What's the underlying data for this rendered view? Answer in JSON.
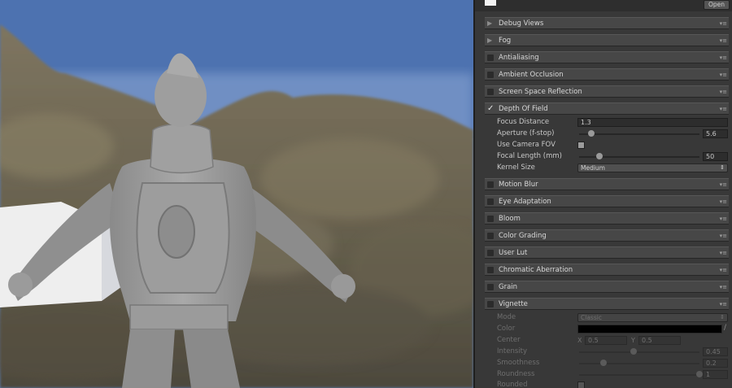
{
  "topbar": {
    "open_label": "Open"
  },
  "sections": {
    "debug_views": {
      "label": "Debug Views"
    },
    "fog": {
      "label": "Fog"
    },
    "antialiasing": {
      "label": "Antialiasing"
    },
    "ambient_occlusion": {
      "label": "Ambient Occlusion"
    },
    "screen_space_reflection": {
      "label": "Screen Space Reflection"
    },
    "depth_of_field": {
      "label": "Depth Of Field"
    },
    "motion_blur": {
      "label": "Motion Blur"
    },
    "eye_adaptation": {
      "label": "Eye Adaptation"
    },
    "bloom": {
      "label": "Bloom"
    },
    "color_grading": {
      "label": "Color Grading"
    },
    "user_lut": {
      "label": "User Lut"
    },
    "chromatic_aberration": {
      "label": "Chromatic Aberration"
    },
    "grain": {
      "label": "Grain"
    },
    "vignette": {
      "label": "Vignette"
    }
  },
  "depth_of_field": {
    "focus_distance": {
      "label": "Focus Distance",
      "value": "1.3"
    },
    "aperture": {
      "label": "Aperture (f-stop)",
      "value": "5.6",
      "fraction": 0.1
    },
    "use_camera_fov": {
      "label": "Use Camera FOV",
      "checked": false
    },
    "focal_length": {
      "label": "Focal Length (mm)",
      "value": "50",
      "fraction": 0.17
    },
    "kernel_size": {
      "label": "Kernel Size",
      "value": "Medium"
    }
  },
  "vignette": {
    "mode": {
      "label": "Mode",
      "value": "Classic"
    },
    "color": {
      "label": "Color",
      "value": "#000000"
    },
    "center": {
      "label": "Center",
      "x_label": "X",
      "x_value": "0.5",
      "y_label": "Y",
      "y_value": "0.5"
    },
    "intensity": {
      "label": "Intensity",
      "value": "0.45",
      "fraction": 0.45
    },
    "smoothness": {
      "label": "Smoothness",
      "value": "0.2",
      "fraction": 0.2
    },
    "roundness": {
      "label": "Roundness",
      "value": "1",
      "fraction": 1.0
    },
    "rounded": {
      "label": "Rounded",
      "checked": false
    }
  },
  "colors": {
    "panel_bg": "#383838",
    "header_bg": "#474747",
    "field_bg": "#2d2d2d"
  },
  "icons": {
    "collapsed": "triangle-right-icon",
    "expanded": "checkmark-icon",
    "menu": "settings-menu-icon",
    "picker": "eyedropper-icon"
  }
}
